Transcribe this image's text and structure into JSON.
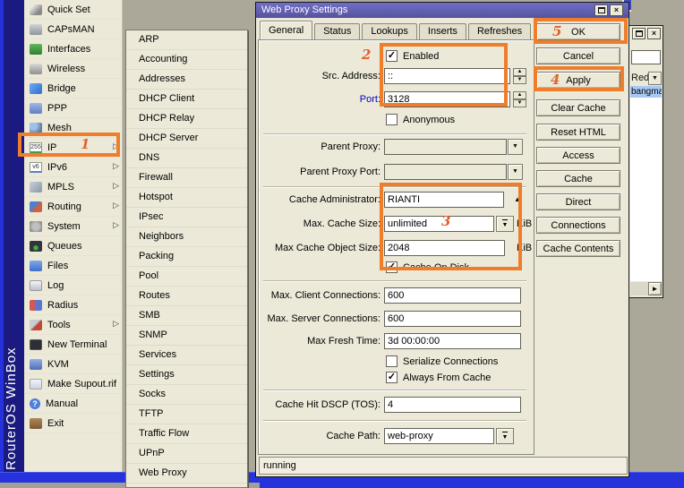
{
  "colors": {
    "annotation_orange": "#ee7e2c",
    "titlebar_blue": "#605fb8",
    "frame_blue": "#2633dc",
    "frame_navy": "#1a1a80",
    "window_cream": "#ece9d8",
    "selection_blue": "#a9c9f5",
    "workspace_gray": "#aba89a"
  },
  "icons": {
    "up": "▲",
    "down": "▼",
    "right_arrow": "▷",
    "scroll_right": "►",
    "check": "✓",
    "close": "×",
    "ip_chip_text": "255",
    "ipv6_chip_text": "v6",
    "manual_text": "?"
  },
  "brand": {
    "vertical_text": "RouterOS WinBox"
  },
  "sidebar": {
    "items": [
      {
        "label": "Quick Set",
        "icon": "wand-icon",
        "has_arrow": false
      },
      {
        "label": "CAPsMAN",
        "icon": "antenna-mast-icon",
        "has_arrow": false
      },
      {
        "label": "Interfaces",
        "icon": "network-card-icon",
        "has_arrow": false
      },
      {
        "label": "Wireless",
        "icon": "wireless-antenna-icon",
        "has_arrow": false
      },
      {
        "label": "Bridge",
        "icon": "bridge-arrows-icon",
        "has_arrow": false
      },
      {
        "label": "PPP",
        "icon": "ppp-monitors-icon",
        "has_arrow": false
      },
      {
        "label": "Mesh",
        "icon": "mesh-nodes-icon",
        "has_arrow": false
      },
      {
        "label": "IP",
        "icon": "ip-chip-icon",
        "has_arrow": true
      },
      {
        "label": "IPv6",
        "icon": "ipv6-chip-icon",
        "has_arrow": true
      },
      {
        "label": "MPLS",
        "icon": "tags-icon",
        "has_arrow": true
      },
      {
        "label": "Routing",
        "icon": "routing-tools-icon",
        "has_arrow": true
      },
      {
        "label": "System",
        "icon": "gear-icon",
        "has_arrow": true
      },
      {
        "label": "Queues",
        "icon": "gauge-icon",
        "has_arrow": false
      },
      {
        "label": "Files",
        "icon": "folder-icon",
        "has_arrow": false
      },
      {
        "label": "Log",
        "icon": "log-paper-icon",
        "has_arrow": false
      },
      {
        "label": "Radius",
        "icon": "users-icon",
        "has_arrow": false
      },
      {
        "label": "Tools",
        "icon": "tools-icon",
        "has_arrow": true
      },
      {
        "label": "New Terminal",
        "icon": "terminal-icon",
        "has_arrow": false
      },
      {
        "label": "KVM",
        "icon": "kvm-monitor-icon",
        "has_arrow": false
      },
      {
        "label": "Make Supout.rif",
        "icon": "document-export-icon",
        "has_arrow": false
      },
      {
        "label": "Manual",
        "icon": "help-icon",
        "has_arrow": false
      },
      {
        "label": "Exit",
        "icon": "exit-door-icon",
        "has_arrow": false
      }
    ]
  },
  "submenu": {
    "items": [
      "ARP",
      "Accounting",
      "Addresses",
      "DHCP Client",
      "DHCP Relay",
      "DHCP Server",
      "DNS",
      "Firewall",
      "Hotspot",
      "IPsec",
      "Neighbors",
      "Packing",
      "Pool",
      "Routes",
      "SMB",
      "SNMP",
      "Services",
      "Settings",
      "Socks",
      "TFTP",
      "Traffic Flow",
      "UPnP",
      "Web Proxy"
    ]
  },
  "dialog": {
    "title": "Web Proxy Settings",
    "tabs": [
      "General",
      "Status",
      "Lookups",
      "Inserts",
      "Refreshes"
    ],
    "fields": {
      "enabled": {
        "label": "Enabled",
        "checked": true
      },
      "src_address": {
        "label": "Src. Address:",
        "value": "::"
      },
      "port": {
        "label": "Port:",
        "value": "3128"
      },
      "anonymous": {
        "label": "Anonymous",
        "checked": false
      },
      "parent_proxy": {
        "label": "Parent Proxy:",
        "value": ""
      },
      "parent_proxy_port": {
        "label": "Parent Proxy Port:",
        "value": ""
      },
      "cache_administrator": {
        "label": "Cache Administrator:",
        "value": "RIANTI"
      },
      "max_cache_size": {
        "label": "Max. Cache Size:",
        "value": "unlimited",
        "unit": "KiB"
      },
      "max_cache_object_size": {
        "label": "Max Cache Object Size:",
        "value": "2048",
        "unit": "KiB"
      },
      "cache_on_disk": {
        "label": "Cache On Disk",
        "checked": true
      },
      "max_client_connections": {
        "label": "Max. Client Connections:",
        "value": "600"
      },
      "max_server_connections": {
        "label": "Max. Server Connections:",
        "value": "600"
      },
      "max_fresh_time": {
        "label": "Max Fresh Time:",
        "value": "3d 00:00:00"
      },
      "serialize_connections": {
        "label": "Serialize Connections",
        "checked": false
      },
      "always_from_cache": {
        "label": "Always From Cache",
        "checked": true
      },
      "cache_hit_dscp": {
        "label": "Cache Hit DSCP (TOS):",
        "value": "4"
      },
      "cache_path": {
        "label": "Cache Path:",
        "value": "web-proxy"
      }
    },
    "buttons": [
      "OK",
      "Cancel",
      "Apply",
      "Clear Cache",
      "Reset HTML",
      "Access",
      "Cache",
      "Direct",
      "Connections",
      "Cache Contents"
    ],
    "status": "running"
  },
  "background_window": {
    "filter_value": "",
    "column_header": "Red",
    "selected_row": "bangma"
  },
  "annotations": {
    "steps": [
      "1",
      "2",
      "3",
      "4",
      "5"
    ]
  }
}
